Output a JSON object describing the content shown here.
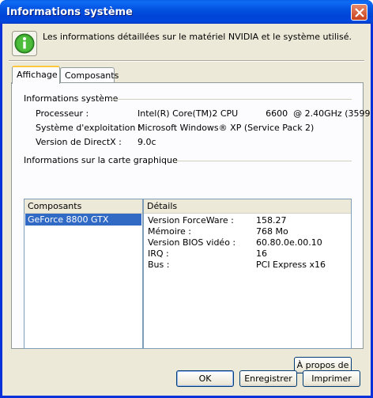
{
  "window": {
    "title": "Informations système"
  },
  "header": {
    "text": "Les informations détaillées sur le matériel NVIDIA et le système utilisé."
  },
  "tabs": [
    {
      "label": "Affichage",
      "active": true
    },
    {
      "label": "Composants",
      "active": false
    }
  ],
  "system_info": {
    "group_label": "Informations système",
    "rows": [
      {
        "label": "Processeur :",
        "value": "Intel(R) Core(TM)2 CPU          6600  @ 2.40GHz (3599"
      },
      {
        "label": "Système d'exploitation :",
        "value": "Microsoft Windows® XP (Service Pack 2)"
      },
      {
        "label": "Version de DirectX :",
        "value": "9.0c"
      }
    ]
  },
  "graphics_info": {
    "group_label": "Informations sur la carte graphique",
    "components_header": "Composants",
    "details_header": "Détails",
    "components": [
      "GeForce 8800 GTX"
    ],
    "details": [
      {
        "label": "Version ForceWare :",
        "value": "158.27"
      },
      {
        "label": "Mémoire :",
        "value": "768 Mo"
      },
      {
        "label": "Version BIOS vidéo :",
        "value": "60.80.0e.00.10"
      },
      {
        "label": "IRQ :",
        "value": "16"
      },
      {
        "label": "Bus :",
        "value": "PCI Express x16"
      }
    ]
  },
  "buttons": {
    "about": "À propos de",
    "ok": "OK",
    "save": "Enregistrer",
    "print": "Imprimer"
  },
  "colors": {
    "titlebar": "#0054e3",
    "face": "#ece9d8",
    "selection": "#316ac5",
    "tab_accent": "#ffc83c"
  }
}
